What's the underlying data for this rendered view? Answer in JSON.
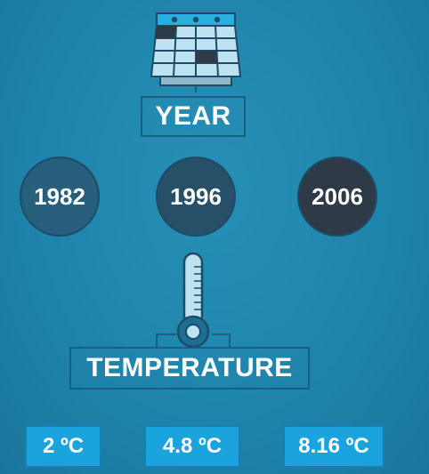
{
  "year_section": {
    "icon": "calendar-icon",
    "label": "YEAR",
    "years": [
      "1982",
      "1996",
      "2006"
    ]
  },
  "temperature_section": {
    "icon": "thermometer-icon",
    "label": "TEMPERATURE",
    "values": [
      "2 ºC",
      "4.8 ºC",
      "8.16 ºC"
    ]
  },
  "colors": {
    "background": "#2088b0",
    "outline": "#1a5f80",
    "year_1982_fill": "#275f7d",
    "year_1996_fill": "#274f68",
    "year_2006_fill": "#2e3a47",
    "value_box_fill": "#1aa3dd",
    "text": "#ffffff"
  }
}
